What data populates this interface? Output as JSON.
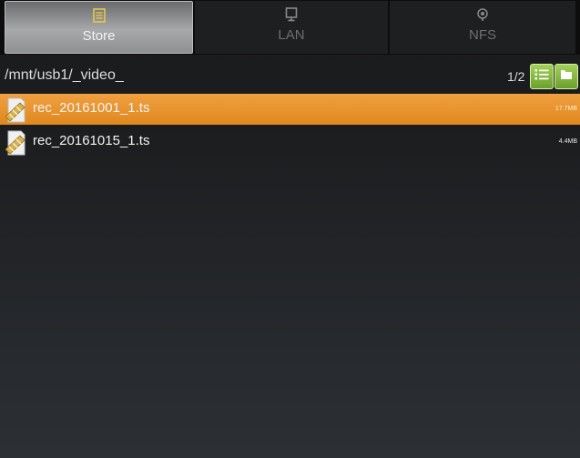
{
  "tabs": [
    {
      "label": "Store",
      "icon": "list-icon",
      "selected": true
    },
    {
      "label": "LAN",
      "icon": "monitor-icon",
      "selected": false
    },
    {
      "label": "NFS",
      "icon": "network-icon",
      "selected": false
    }
  ],
  "path": "/mnt/usb1/_video_",
  "pager": "1/2",
  "toolbar": {
    "list_icon": "list-view-icon",
    "folder_icon": "folder-icon"
  },
  "files": [
    {
      "name": "rec_20161001_1.ts",
      "size": "17.7MB",
      "selected": true
    },
    {
      "name": "rec_20161015_1.ts",
      "size": "4.4MB",
      "selected": false
    }
  ],
  "colors": {
    "accent": "#e8901f",
    "button": "#8cbf44",
    "active_tab_icon": "#e6c84a"
  }
}
